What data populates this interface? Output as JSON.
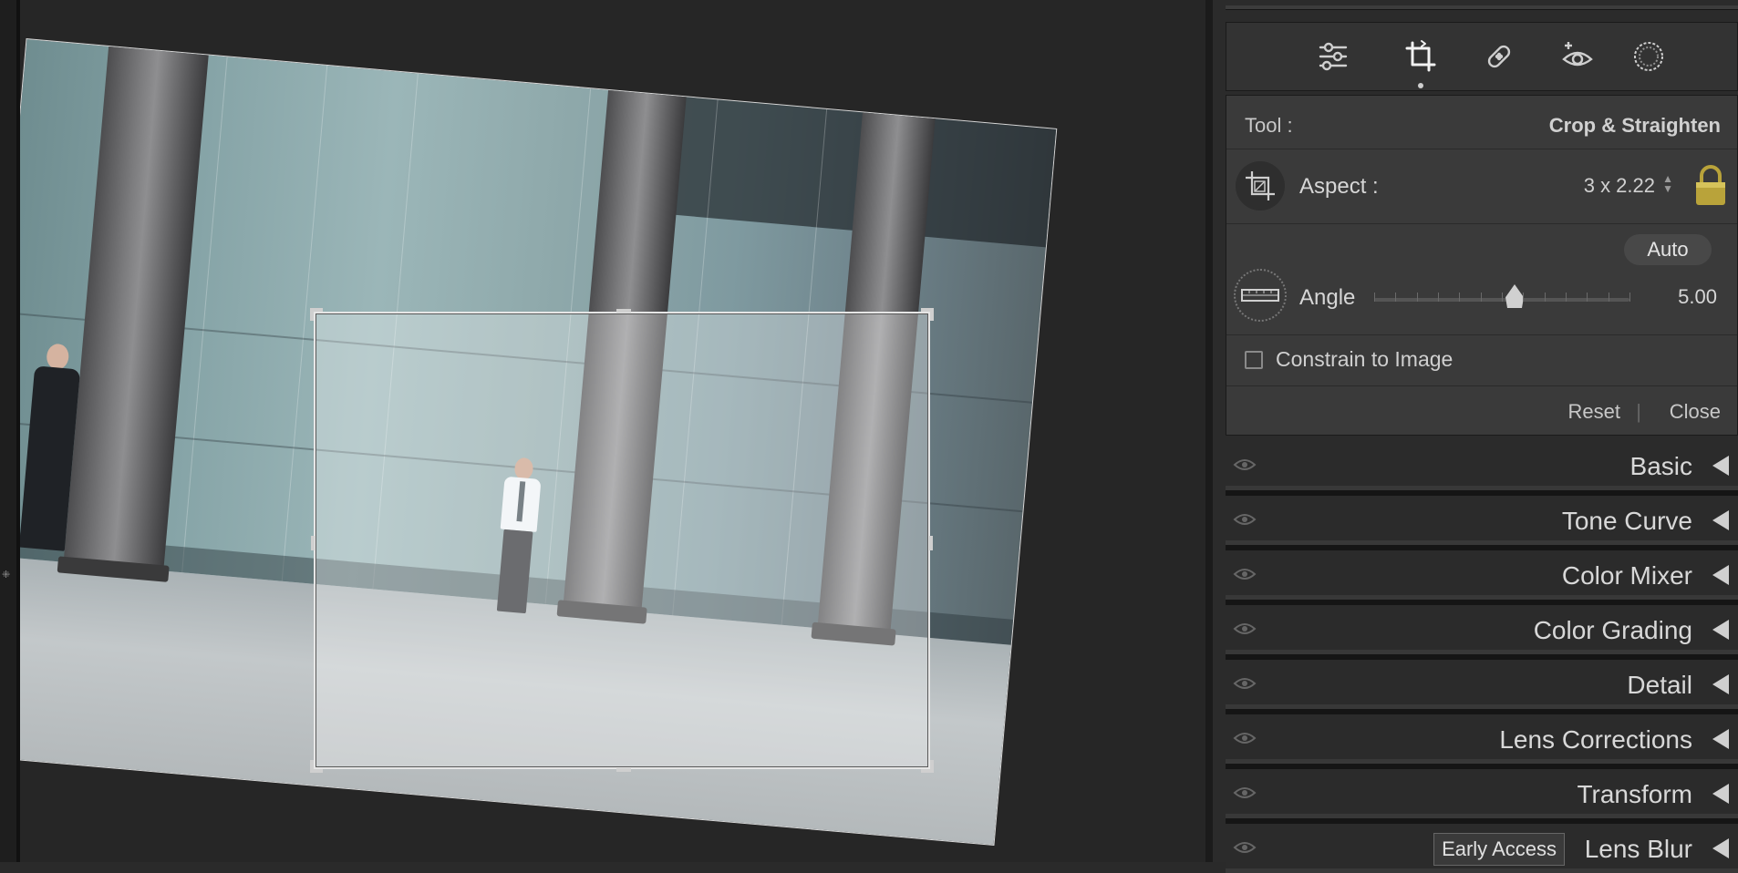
{
  "tools": {
    "items": [
      {
        "name": "edit",
        "icon": "sliders-icon"
      },
      {
        "name": "crop",
        "icon": "crop-rotate-icon",
        "active": true
      },
      {
        "name": "healing",
        "icon": "bandage-icon"
      },
      {
        "name": "red-eye",
        "icon": "red-eye-icon"
      },
      {
        "name": "masking",
        "icon": "masking-icon"
      }
    ]
  },
  "crop_panel": {
    "tool_label": "Tool :",
    "tool_value": "Crop & Straighten",
    "aspect_label": "Aspect :",
    "aspect_value": "3 x 2.22",
    "aspect_locked": true,
    "auto_label": "Auto",
    "angle_label": "Angle",
    "angle_value": "5.00",
    "angle_slider_fraction": 0.55,
    "constrain_label": "Constrain to Image",
    "constrain_checked": false,
    "reset_label": "Reset",
    "separator": "|",
    "close_label": "Close"
  },
  "sections": [
    {
      "title": "Basic"
    },
    {
      "title": "Tone Curve"
    },
    {
      "title": "Color Mixer"
    },
    {
      "title": "Color Grading"
    },
    {
      "title": "Detail"
    },
    {
      "title": "Lens Corrections"
    },
    {
      "title": "Transform"
    },
    {
      "title": "Lens Blur",
      "badge": "Early Access"
    }
  ],
  "colors": {
    "panel_bg": "#2b2b2b",
    "subpanel_bg": "#3a3a3a",
    "lock_gold": "#b9a33a"
  }
}
